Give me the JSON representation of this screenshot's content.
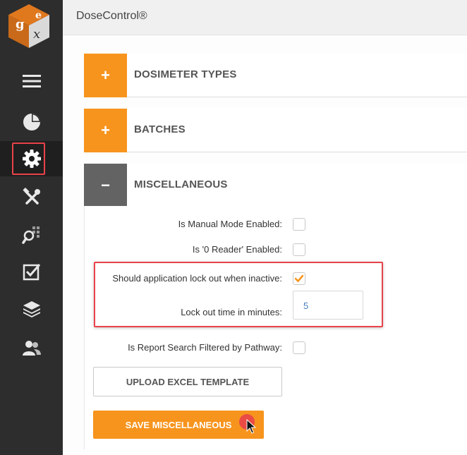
{
  "app": {
    "title": "DoseControl®"
  },
  "sidebar": {
    "items": [
      {
        "icon": "menu-icon"
      },
      {
        "icon": "pie-chart-icon"
      },
      {
        "icon": "gear-icon",
        "active": true
      },
      {
        "icon": "tools-icon"
      },
      {
        "icon": "search-grid-icon"
      },
      {
        "icon": "checkbox-icon"
      },
      {
        "icon": "layers-icon"
      },
      {
        "icon": "users-icon"
      }
    ]
  },
  "panels": [
    {
      "title": "DOSIMETER TYPES",
      "toggle": "+",
      "expanded": false
    },
    {
      "title": "BATCHES",
      "toggle": "+",
      "expanded": false
    },
    {
      "title": "MISCELLANEOUS",
      "toggle": "−",
      "expanded": true
    }
  ],
  "misc": {
    "manual_mode": {
      "label": "Is Manual Mode Enabled:",
      "checked": false
    },
    "zero_reader": {
      "label": "Is '0 Reader' Enabled:",
      "checked": false
    },
    "lock_out": {
      "label": "Should application lock out when inactive:",
      "checked": true
    },
    "lock_time": {
      "label": "Lock out time in minutes:",
      "value": "5"
    },
    "report_filter": {
      "label": "Is Report Search Filtered by Pathway:",
      "checked": false
    },
    "upload_label": "UPLOAD EXCEL TEMPLATE",
    "save_label": "SAVE MISCELLANEOUS"
  },
  "colors": {
    "accent": "#f7941d",
    "sidebar": "#2d2d2d",
    "highlight": "#e8434a",
    "collapsed_toggle": "#636363"
  }
}
